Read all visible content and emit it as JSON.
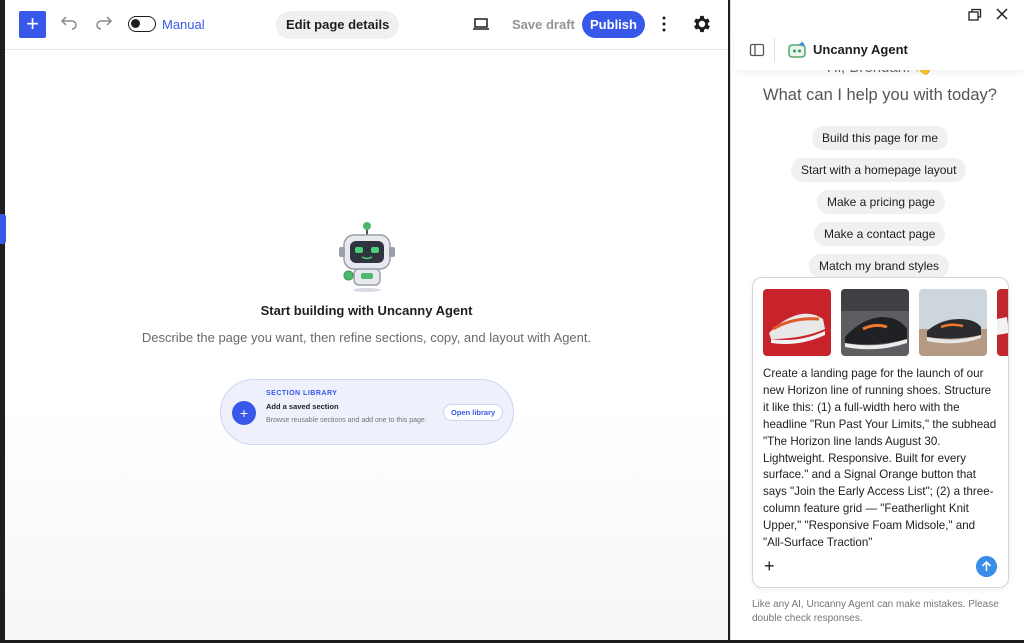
{
  "toolbar": {
    "add_label": "+",
    "manual_label": "Manual",
    "edit_page_details": "Edit page details",
    "save_draft": "Save draft",
    "publish": "Publish"
  },
  "canvas": {
    "empty_title": "Start building with Uncanny Agent",
    "empty_subtitle": "Describe the page you want, then refine sections, copy, and layout with Agent.",
    "section_card": {
      "eyebrow": "SECTION LIBRARY",
      "title": "Add a saved section",
      "description": "Browse reusable sections and add one to this page.",
      "button": "Open library",
      "plus": "+"
    }
  },
  "agent_panel": {
    "title": "Uncanny Agent",
    "greeting": "Hi, Brendan! 👋",
    "question": "What can I help you with today?",
    "suggestions": [
      "Build this page for me",
      "Start with a homepage layout",
      "Make a pricing page",
      "Make a contact page",
      "Match my brand styles"
    ],
    "prompt": "Create a landing page for the launch of our new Horizon line of running shoes. Structure it like this: (1) a full-width hero with the headline \"Run Past Your Limits,\" the subhead \"The Horizon line lands August 30. Lightweight. Responsive. Built for every surface.\" and a Signal Orange button that says \"Join the Early Access List\"; (2) a three-column feature grid — \"Featherlight Knit Upper,\" \"Responsive Foam Midsole,\" and \"All-Surface Traction\"",
    "attach_label": "+",
    "disclaimer": "Like any AI, Uncanny Agent can make mistakes. Please double check responses."
  },
  "colors": {
    "accent": "#3858e9",
    "send": "#3a8ee6",
    "chip_bg": "#f0f0f0"
  }
}
